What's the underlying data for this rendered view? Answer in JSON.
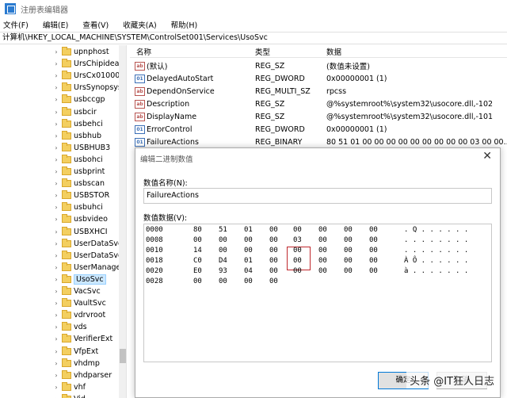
{
  "window": {
    "title": "注册表编辑器"
  },
  "menu": [
    "文件(F)",
    "编辑(E)",
    "查看(V)",
    "收藏夹(A)",
    "帮助(H)"
  ],
  "address": "计算机\\HKEY_LOCAL_MACHINE\\SYSTEM\\ControlSet001\\Services\\UsoSvc",
  "tree": {
    "items": [
      "upnphost",
      "UrsChipidea",
      "UrsCx01000",
      "UrsSynopsys",
      "usbccgp",
      "usbcir",
      "usbehci",
      "usbhub",
      "USBHUB3",
      "usbohci",
      "usbprint",
      "usbscan",
      "USBSTOR",
      "usbuhci",
      "usbvideo",
      "USBXHCI",
      "UserDataSvc",
      "UserDataSvc_",
      "UserManager",
      "UsoSvc",
      "VacSvc",
      "VaultSvc",
      "vdrvroot",
      "vds",
      "VerifierExt",
      "VfpExt",
      "vhdmp",
      "vhdparser",
      "vhf",
      "Vid"
    ],
    "selected": "UsoSvc"
  },
  "values": {
    "headers": {
      "name": "名称",
      "type": "类型",
      "data": "数据"
    },
    "rows": [
      {
        "icon": "ab",
        "name": "(默认)",
        "type": "REG_SZ",
        "data": "(数值未设置)"
      },
      {
        "icon": "bin",
        "name": "DelayedAutoStart",
        "type": "REG_DWORD",
        "data": "0x00000001 (1)"
      },
      {
        "icon": "ab",
        "name": "DependOnService",
        "type": "REG_MULTI_SZ",
        "data": "rpcss"
      },
      {
        "icon": "ab",
        "name": "Description",
        "type": "REG_SZ",
        "data": "@%systemroot%\\system32\\usocore.dll,-102"
      },
      {
        "icon": "ab",
        "name": "DisplayName",
        "type": "REG_SZ",
        "data": "@%systemroot%\\system32\\usocore.dll,-101"
      },
      {
        "icon": "bin",
        "name": "ErrorControl",
        "type": "REG_DWORD",
        "data": "0x00000001 (1)"
      },
      {
        "icon": "bin",
        "name": "FailureActions",
        "type": "REG_BINARY",
        "data": "80 51 01 00 00 00 00 00 00 00 00 00 03 00 00..."
      }
    ]
  },
  "dialog": {
    "title": "编辑二进制数值",
    "name_label": "数值名称(N):",
    "name_value": "FailureActions",
    "data_label": "数值数据(V):",
    "hex_rows": [
      {
        "addr": "0000",
        "bytes": [
          "80",
          "51",
          "01",
          "00",
          "00",
          "00",
          "00",
          "00"
        ],
        "ascii": ". Q . . . . . ."
      },
      {
        "addr": "0008",
        "bytes": [
          "00",
          "00",
          "00",
          "00",
          "03",
          "00",
          "00",
          "00"
        ],
        "ascii": ". . . . . . . ."
      },
      {
        "addr": "0010",
        "bytes": [
          "14",
          "00",
          "00",
          "00",
          "00",
          "00",
          "00",
          "00"
        ],
        "ascii": ". . . . . . . ."
      },
      {
        "addr": "0018",
        "bytes": [
          "C0",
          "D4",
          "01",
          "00",
          "00",
          "00",
          "00",
          "00"
        ],
        "ascii": "À Ô . . . . . ."
      },
      {
        "addr": "0020",
        "bytes": [
          "E0",
          "93",
          "04",
          "00",
          "00",
          "00",
          "00",
          "00"
        ],
        "ascii": "à . . . . . . ."
      },
      {
        "addr": "0028",
        "bytes": [
          "00",
          "00",
          "00",
          "00",
          "",
          "",
          "",
          ""
        ],
        "ascii": ""
      }
    ],
    "ok_label": "确定",
    "cancel_label": "取消"
  },
  "watermark": "头条 @IT狂人日志"
}
